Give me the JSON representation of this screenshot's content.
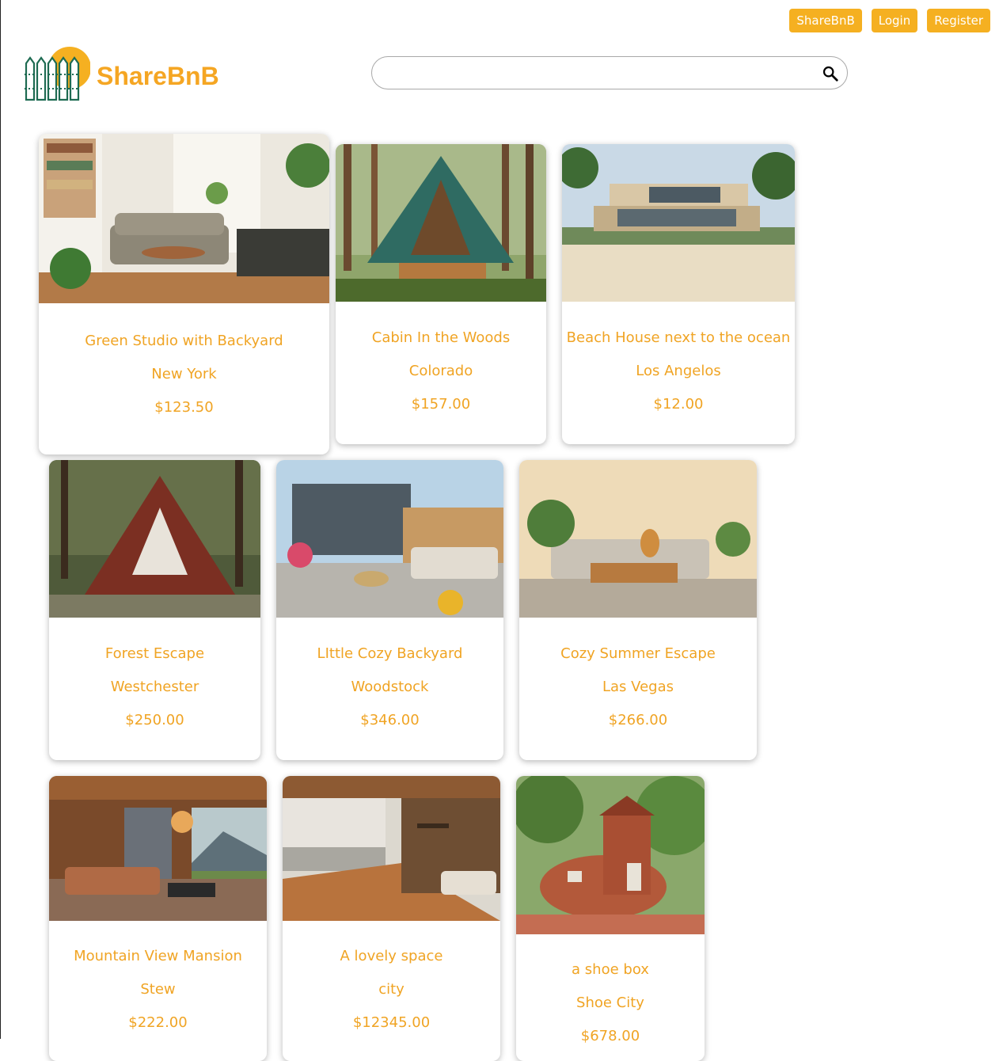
{
  "nav": {
    "home_label": "ShareBnB",
    "login_label": "Login",
    "register_label": "Register"
  },
  "brand": {
    "name": "ShareBnB"
  },
  "search": {
    "value": "",
    "placeholder": ""
  },
  "colors": {
    "accent": "#f5b021",
    "brand_text": "#f5a623",
    "card_text": "#f0a424",
    "logo_green": "#1e6b52"
  },
  "listings": [
    {
      "title": "Green Studio with Backyard",
      "location": "New York",
      "price": "$123.50",
      "photo": "bright living room with plants"
    },
    {
      "title": "Cabin In the Woods",
      "location": "Colorado",
      "price": "$157.00",
      "photo": "A-frame cabin in forest"
    },
    {
      "title": "Beach House next to the ocean",
      "location": "Los Angelos",
      "price": "$12.00",
      "photo": "modern beach house on sand"
    },
    {
      "title": "Forest Escape",
      "location": "Westchester",
      "price": "$250.00",
      "photo": "red A-frame cabin"
    },
    {
      "title": "LIttle Cozy Backyard",
      "location": "Woodstock",
      "price": "$346.00",
      "photo": "backyard patio with seating"
    },
    {
      "title": "Cozy Summer Escape",
      "location": "Las Vegas",
      "price": "$266.00",
      "photo": "patio with dog on sofa"
    },
    {
      "title": "Mountain View Mansion",
      "location": "Stew",
      "price": "$222.00",
      "photo": "living room with mountain view"
    },
    {
      "title": "A lovely space",
      "location": "city",
      "price": "$12345.00",
      "photo": "open deck overlooking water"
    },
    {
      "title": "a shoe box",
      "location": "Shoe City",
      "price": "$678.00",
      "photo": "shoe-shaped house"
    }
  ]
}
